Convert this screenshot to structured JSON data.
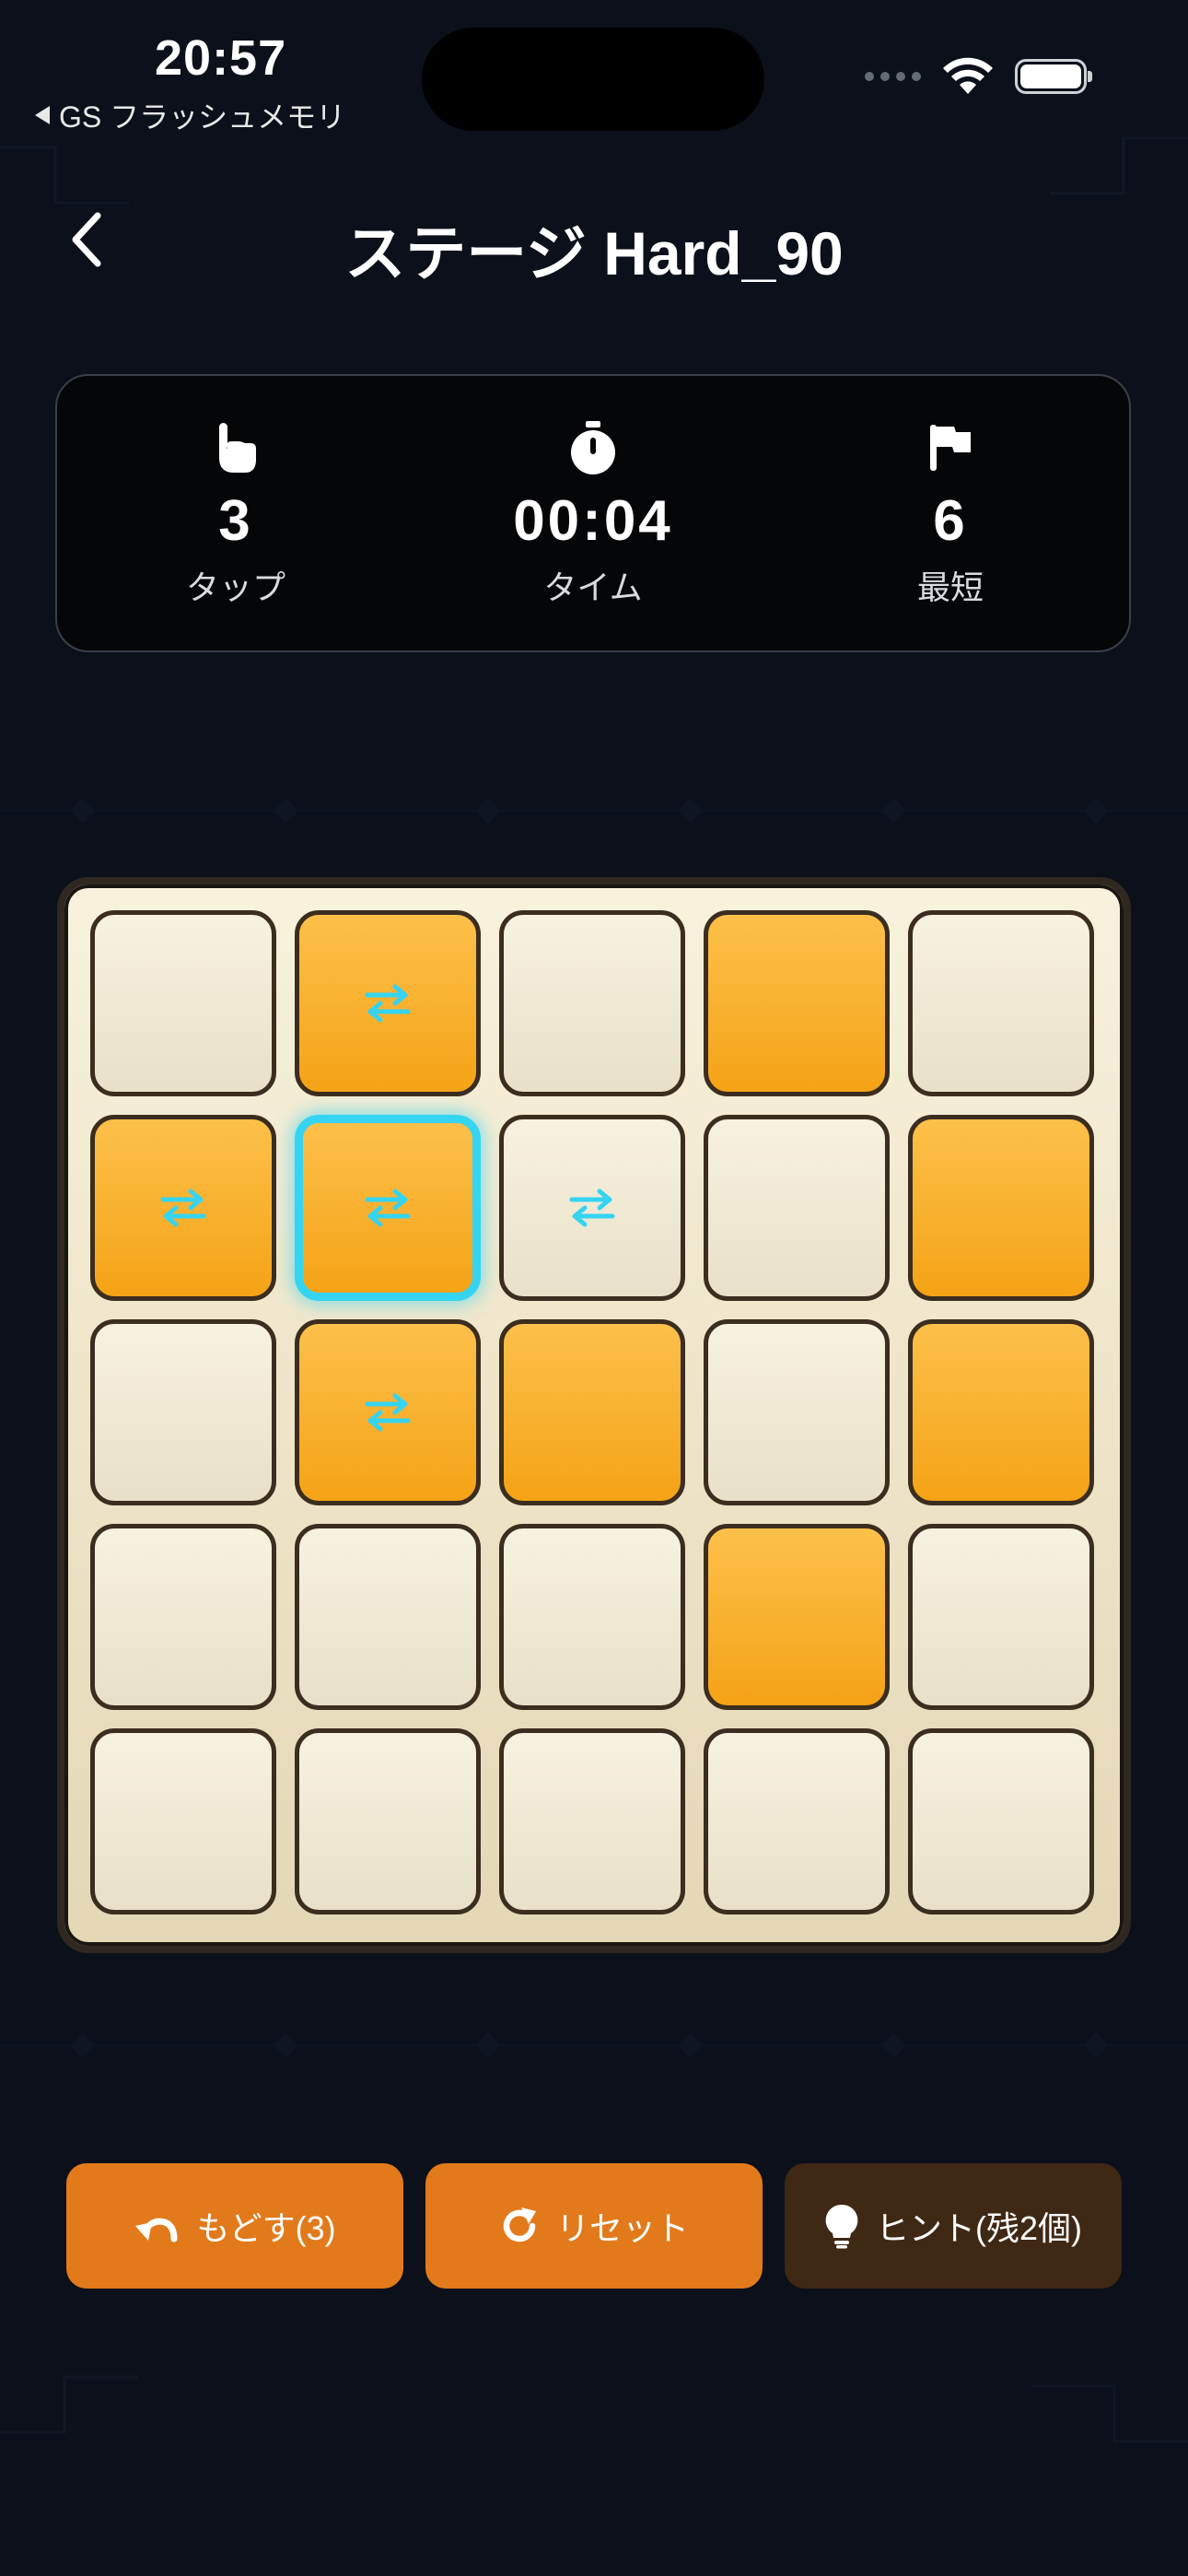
{
  "status_bar": {
    "time": "20:57",
    "back_app": "GS フラッシュメモリ"
  },
  "header": {
    "title": "ステージ Hard_90"
  },
  "stats": [
    {
      "icon": "tap-hand-icon",
      "value": "3",
      "label": "タップ"
    },
    {
      "icon": "stopwatch-icon",
      "value": "00:04",
      "label": "タイム"
    },
    {
      "icon": "flag-icon",
      "value": "6",
      "label": "最短"
    }
  ],
  "board": {
    "rows": 5,
    "cols": 5,
    "cells": [
      [
        {
          "on": false,
          "swap": false
        },
        {
          "on": true,
          "swap": true
        },
        {
          "on": false,
          "swap": false
        },
        {
          "on": true,
          "swap": false
        },
        {
          "on": false,
          "swap": false
        }
      ],
      [
        {
          "on": true,
          "swap": true
        },
        {
          "on": true,
          "swap": true,
          "selected": true
        },
        {
          "on": false,
          "swap": true
        },
        {
          "on": false,
          "swap": false
        },
        {
          "on": true,
          "swap": false
        }
      ],
      [
        {
          "on": false,
          "swap": false
        },
        {
          "on": true,
          "swap": true
        },
        {
          "on": true,
          "swap": false
        },
        {
          "on": false,
          "swap": false
        },
        {
          "on": true,
          "swap": false
        }
      ],
      [
        {
          "on": false,
          "swap": false
        },
        {
          "on": false,
          "swap": false
        },
        {
          "on": false,
          "swap": false
        },
        {
          "on": true,
          "swap": false
        },
        {
          "on": false,
          "swap": false
        }
      ],
      [
        {
          "on": false,
          "swap": false
        },
        {
          "on": false,
          "swap": false
        },
        {
          "on": false,
          "swap": false
        },
        {
          "on": false,
          "swap": false
        },
        {
          "on": false,
          "swap": false
        }
      ]
    ]
  },
  "actions": {
    "undo_label": "もどす(3)",
    "reset_label": "リセット",
    "hint_label": "ヒント(残2個)"
  },
  "colors": {
    "background": "#0b101a",
    "tile_on": "#f5a316",
    "tile_off": "#f0e9d2",
    "selection": "#35d4f2",
    "button_orange": "#e27a1b",
    "button_brown": "#3f2814"
  }
}
